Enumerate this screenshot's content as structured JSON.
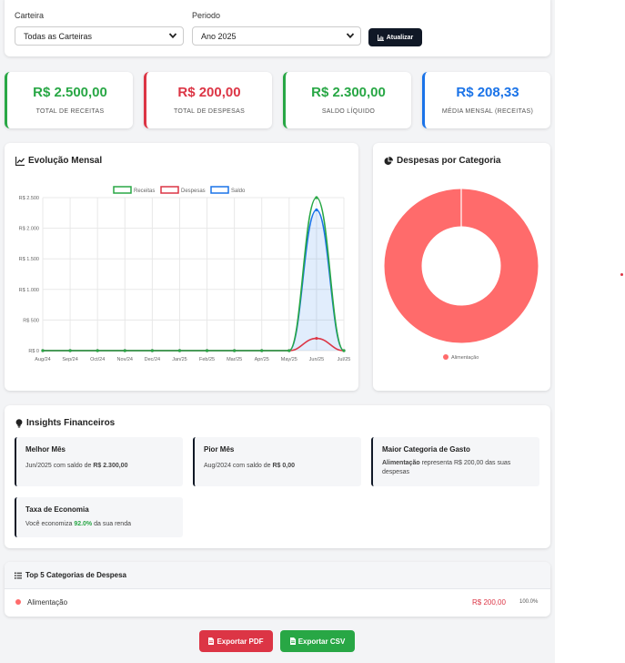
{
  "filters": {
    "wallet_label": "Carteira",
    "wallet_value": "Todas as Carteiras",
    "period_label": "Periodo",
    "period_value": "Ano 2025",
    "refresh_label": "Atualizar"
  },
  "stats": [
    {
      "value": "R$ 2.500,00",
      "caption": "TOTAL DE RECEITAS",
      "color": "#28a745"
    },
    {
      "value": "R$ 200,00",
      "caption": "TOTAL DE DESPESAS",
      "color": "#dc3545"
    },
    {
      "value": "R$ 2.300,00",
      "caption": "SALDO LÍQUIDO",
      "color": "#28a745"
    },
    {
      "value": "R$ 208,33",
      "caption": "MÉDIA MENSAL (RECEITAS)",
      "color": "#1a73e8"
    }
  ],
  "evolution": {
    "title": "Evolução Mensal"
  },
  "expenses_by_category": {
    "title": "Despesas por Categoria",
    "legend": "Alimentação"
  },
  "chart_data": [
    {
      "type": "line",
      "x": [
        "Aug/24",
        "Sep/24",
        "Oct/24",
        "Nov/24",
        "Dec/24",
        "Jan/25",
        "Feb/25",
        "Mar/25",
        "Apr/25",
        "May/25",
        "Jun/25",
        "Jul/25"
      ],
      "series": [
        {
          "name": "Receitas",
          "color": "#28a745",
          "values": [
            0,
            0,
            0,
            0,
            0,
            0,
            0,
            0,
            0,
            0,
            2500,
            0
          ]
        },
        {
          "name": "Despesas",
          "color": "#dc3545",
          "values": [
            0,
            0,
            0,
            0,
            0,
            0,
            0,
            0,
            0,
            0,
            200,
            0
          ]
        },
        {
          "name": "Saldo",
          "color": "#1a73e8",
          "values": [
            0,
            0,
            0,
            0,
            0,
            0,
            0,
            0,
            0,
            0,
            2300,
            0
          ]
        }
      ],
      "yticks": [
        "R$ 0",
        "R$ 500",
        "R$ 1.000",
        "R$ 1.500",
        "R$ 2.000",
        "R$ 2.500"
      ],
      "ylim": [
        0,
        2500
      ],
      "grid": true,
      "legend": "top"
    },
    {
      "type": "pie",
      "variant": "doughnut",
      "labels": [
        "Alimentação"
      ],
      "values": [
        200
      ],
      "colors": [
        "#ff6b6b"
      ],
      "legend": "bottom"
    }
  ],
  "insights": {
    "title": "Insights Financeiros",
    "best_month": {
      "heading": "Melhor Mês",
      "text_a": "Jun/2025 com saldo de ",
      "text_b": "R$ 2.300,00"
    },
    "worst_month": {
      "heading": "Pior Mês",
      "text_a": "Aug/2024 com saldo de ",
      "text_b": "R$ 0,00"
    },
    "top_category": {
      "heading": "Maior Categoria de Gasto",
      "text_a": "Alimentação",
      "text_b": " representa R$ 200,00 das suas despesas"
    },
    "savings": {
      "heading": "Taxa de Economia",
      "text_a": "Você economiza ",
      "text_b": "92.0%",
      "text_c": " da sua renda"
    }
  },
  "top5": {
    "title": "Top 5 Categorias de Despesa",
    "rows": [
      {
        "name": "Alimentação",
        "amount": "R$ 200,00",
        "percent": "100.0%",
        "color": "#ff6b6b"
      }
    ]
  },
  "actions": {
    "pdf_label": "Exportar PDF",
    "csv_label": "Exportar CSV"
  }
}
